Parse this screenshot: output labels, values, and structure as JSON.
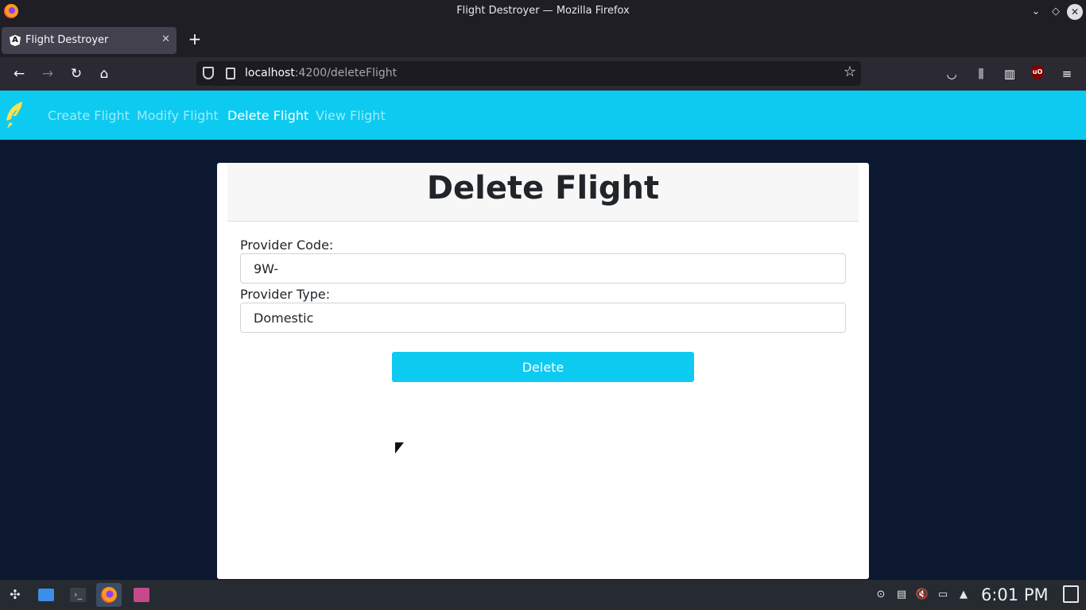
{
  "window": {
    "title": "Flight Destroyer — Mozilla Firefox"
  },
  "browser": {
    "tab": {
      "title": "Flight Destroyer",
      "close": "✕"
    },
    "new_tab": "+",
    "url_host": "localhost",
    "url_rest": ":4200/deleteFlight"
  },
  "app": {
    "nav": {
      "items": [
        {
          "label": "Create Flight",
          "active": false
        },
        {
          "label": "Modify Flight",
          "active": false
        },
        {
          "label": "Delete Flight",
          "active": true
        },
        {
          "label": "View Flight",
          "active": false
        }
      ]
    },
    "card": {
      "title": "Delete Flight",
      "provider_code_label": "Provider Code:",
      "provider_code_value": "9W-",
      "provider_type_label": "Provider Type:",
      "provider_type_value": "Domestic",
      "delete_label": "Delete"
    },
    "colors": {
      "accent": "#0dcaf0",
      "background": "#0b1830"
    }
  },
  "taskbar": {
    "clock": "6:01 PM"
  },
  "icons": [
    "firefox-icon",
    "minimize-icon",
    "maximize-icon",
    "close-icon",
    "back-icon",
    "forward-icon",
    "reload-icon",
    "home-icon",
    "shield-icon",
    "star-icon",
    "pocket-icon",
    "library-icon",
    "sidebar-icon",
    "ublock-icon",
    "menu-icon",
    "app-logo-icon"
  ]
}
